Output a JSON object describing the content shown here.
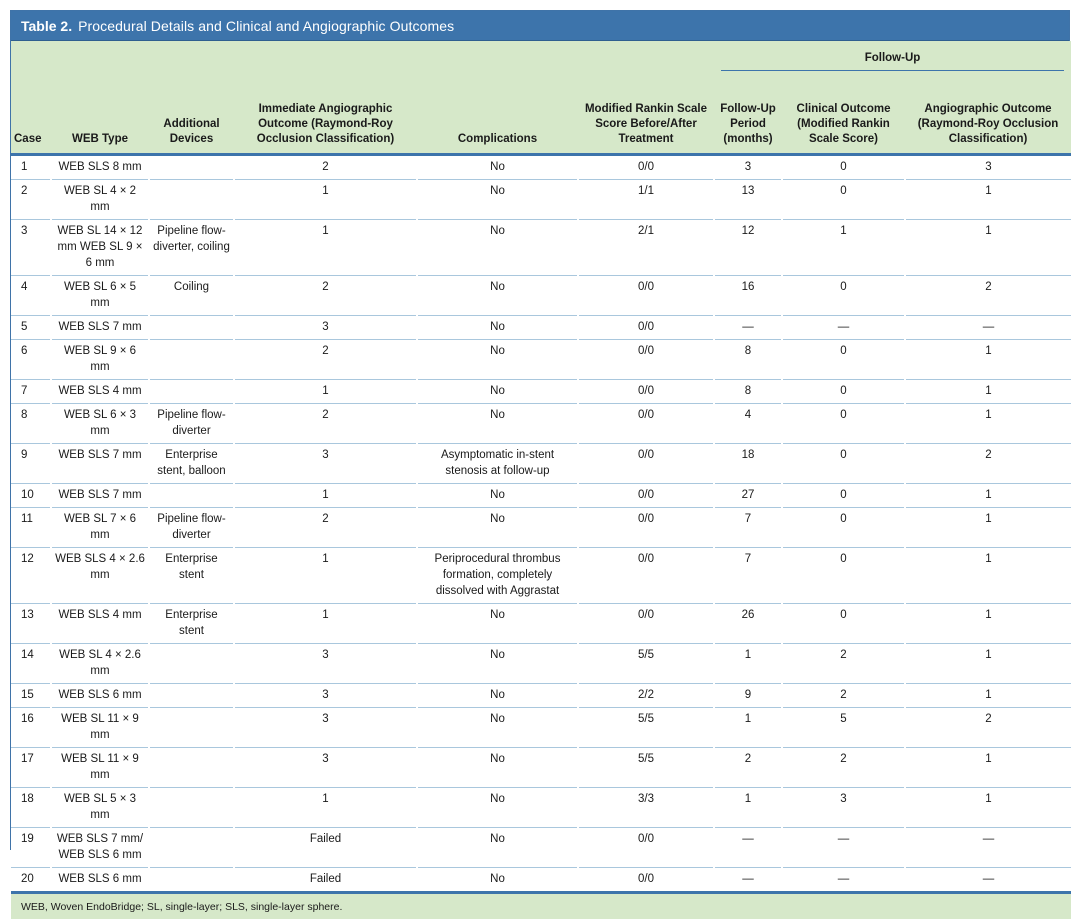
{
  "title": {
    "label": "Table 2.",
    "text": "Procedural Details and Clinical and Angiographic Outcomes"
  },
  "group_header": "Follow-Up",
  "columns": [
    "Case",
    "WEB Type",
    "Additional Devices",
    "Immediate Angiographic Outcome (Raymond-Roy Occlusion Classification)",
    "Complications",
    "Modified Rankin Scale Score Before/After Treatment",
    "Follow-Up Period (months)",
    "Clinical Outcome (Modified Rankin Scale Score)",
    "Angiographic Outcome (Raymond-Roy Occlusion Classification)"
  ],
  "rows": [
    [
      "1",
      "WEB SLS 8 mm",
      "",
      "2",
      "No",
      "0/0",
      "3",
      "0",
      "3"
    ],
    [
      "2",
      "WEB SL 4 × 2 mm",
      "",
      "1",
      "No",
      "1/1",
      "13",
      "0",
      "1"
    ],
    [
      "3",
      "WEB SL 14 × 12 mm WEB SL 9 × 6 mm",
      "Pipeline flow-diverter, coiling",
      "1",
      "No",
      "2/1",
      "12",
      "1",
      "1"
    ],
    [
      "4",
      "WEB SL 6 × 5 mm",
      "Coiling",
      "2",
      "No",
      "0/0",
      "16",
      "0",
      "2"
    ],
    [
      "5",
      "WEB SLS 7 mm",
      "",
      "3",
      "No",
      "0/0",
      "—",
      "—",
      "—"
    ],
    [
      "6",
      "WEB SL 9 × 6 mm",
      "",
      "2",
      "No",
      "0/0",
      "8",
      "0",
      "1"
    ],
    [
      "7",
      "WEB SLS 4 mm",
      "",
      "1",
      "No",
      "0/0",
      "8",
      "0",
      "1"
    ],
    [
      "8",
      "WEB SL 6 × 3 mm",
      "Pipeline flow-diverter",
      "2",
      "No",
      "0/0",
      "4",
      "0",
      "1"
    ],
    [
      "9",
      "WEB SLS 7 mm",
      "Enterprise stent, balloon",
      "3",
      "Asymptomatic in-stent stenosis at follow-up",
      "0/0",
      "18",
      "0",
      "2"
    ],
    [
      "10",
      "WEB SLS 7 mm",
      "",
      "1",
      "No",
      "0/0",
      "27",
      "0",
      "1"
    ],
    [
      "11",
      "WEB SL 7 × 6 mm",
      "Pipeline flow-diverter",
      "2",
      "No",
      "0/0",
      "7",
      "0",
      "1"
    ],
    [
      "12",
      "WEB SLS 4 × 2.6 mm",
      "Enterprise stent",
      "1",
      "Periprocedural thrombus formation, completely dissolved with Aggrastat",
      "0/0",
      "7",
      "0",
      "1"
    ],
    [
      "13",
      "WEB SLS 4 mm",
      "Enterprise stent",
      "1",
      "No",
      "0/0",
      "26",
      "0",
      "1"
    ],
    [
      "14",
      "WEB SL 4 × 2.6 mm",
      "",
      "3",
      "No",
      "5/5",
      "1",
      "2",
      "1"
    ],
    [
      "15",
      "WEB SLS 6 mm",
      "",
      "3",
      "No",
      "2/2",
      "9",
      "2",
      "1"
    ],
    [
      "16",
      "WEB SL 11 × 9 mm",
      "",
      "3",
      "No",
      "5/5",
      "1",
      "5",
      "2"
    ],
    [
      "17",
      "WEB SL 11 × 9 mm",
      "",
      "3",
      "No",
      "5/5",
      "2",
      "2",
      "1"
    ],
    [
      "18",
      "WEB SL 5 × 3 mm",
      "",
      "1",
      "No",
      "3/3",
      "1",
      "3",
      "1"
    ],
    [
      "19",
      "WEB SLS 7 mm/ WEB SLS 6 mm",
      "",
      "Failed",
      "No",
      "0/0",
      "—",
      "—",
      "—"
    ],
    [
      "20",
      "WEB SLS 6 mm",
      "",
      "Failed",
      "No",
      "0/0",
      "—",
      "—",
      "—"
    ]
  ],
  "footnote": "WEB, Woven EndoBridge; SL, single-layer; SLS, single-layer sphere.",
  "colors": {
    "header_bar": "#3d74ab",
    "header_bg": "#d6e8c9",
    "rule": "#a9c7dd"
  }
}
